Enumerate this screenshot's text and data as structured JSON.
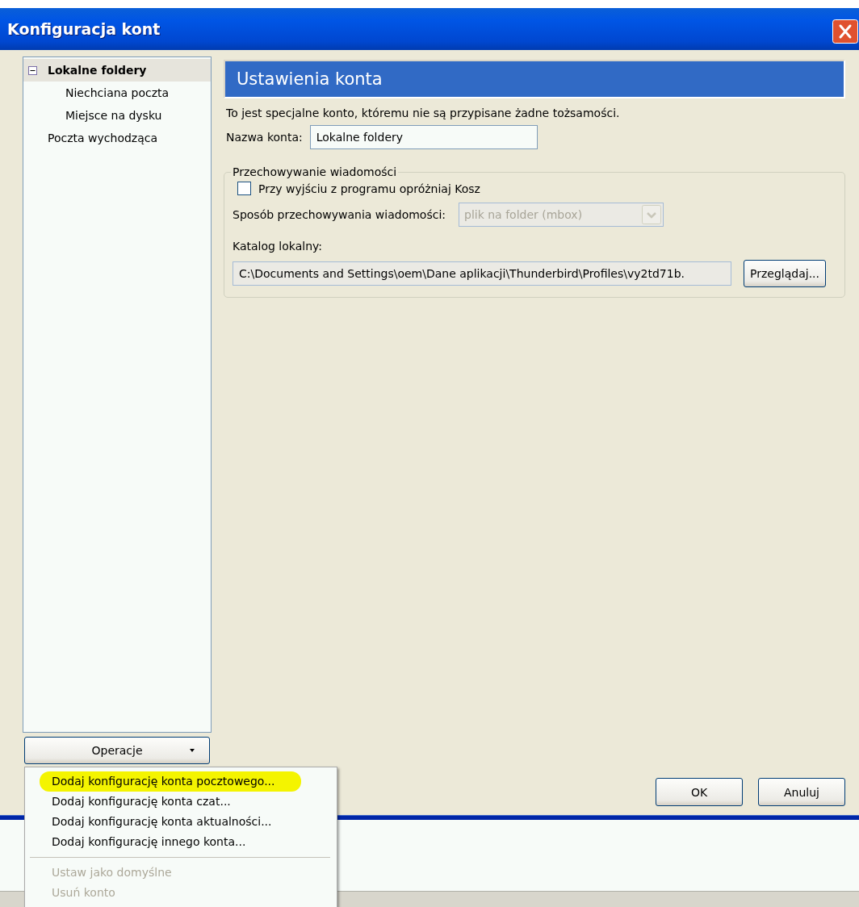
{
  "window": {
    "title": "Konfiguracja kont"
  },
  "tree": [
    {
      "label": "Lokalne foldery",
      "selected": true,
      "expanded": true,
      "children": [
        {
          "label": "Niechciana poczta",
          "selected": false
        },
        {
          "label": "Miejsce na dysku",
          "selected": false
        }
      ]
    },
    {
      "label": "Poczta wychodząca",
      "selected": false
    }
  ],
  "operations_button": {
    "label": "Operacje"
  },
  "panel": {
    "title": "Ustawienia konta",
    "description": "To jest specjalne konto, któremu nie są przypisane żadne tożsamości.",
    "account_name": {
      "label": "Nazwa konta:",
      "value": "Lokalne foldery"
    },
    "storage": {
      "legend": "Przechowywanie wiadomości",
      "empty_trash": {
        "label": "Przy wyjściu z programu opróżniaj Kosz",
        "checked": false
      },
      "store_type": {
        "label": "Sposób przechowywania wiadomości:",
        "value": "plik na folder (mbox)",
        "disabled": true
      },
      "local_dir": {
        "label": "Katalog lokalny:",
        "value": "C:\\Documents and Settings\\oem\\Dane aplikacji\\Thunderbird\\Profiles\\vy2td71b.",
        "button": "Przeglądaj..."
      }
    }
  },
  "buttons": [
    "OK",
    "Anuluj"
  ],
  "menu": {
    "items": [
      {
        "kind": "item",
        "label": "Dodaj konfigurację konta pocztowego...",
        "disabled": false,
        "highlighted": true
      },
      {
        "kind": "item",
        "label": "Dodaj konfigurację konta czat...",
        "disabled": false,
        "highlighted": false
      },
      {
        "kind": "item",
        "label": "Dodaj konfigurację konta aktualności...",
        "disabled": false,
        "highlighted": false
      },
      {
        "kind": "item",
        "label": "Dodaj konfigurację innego konta...",
        "disabled": false,
        "highlighted": false
      },
      {
        "kind": "separator"
      },
      {
        "kind": "item",
        "label": "Ustaw jako domyślne",
        "disabled": true,
        "highlighted": false
      },
      {
        "kind": "item",
        "label": "Usuń konto",
        "disabled": true,
        "highlighted": false
      }
    ]
  }
}
